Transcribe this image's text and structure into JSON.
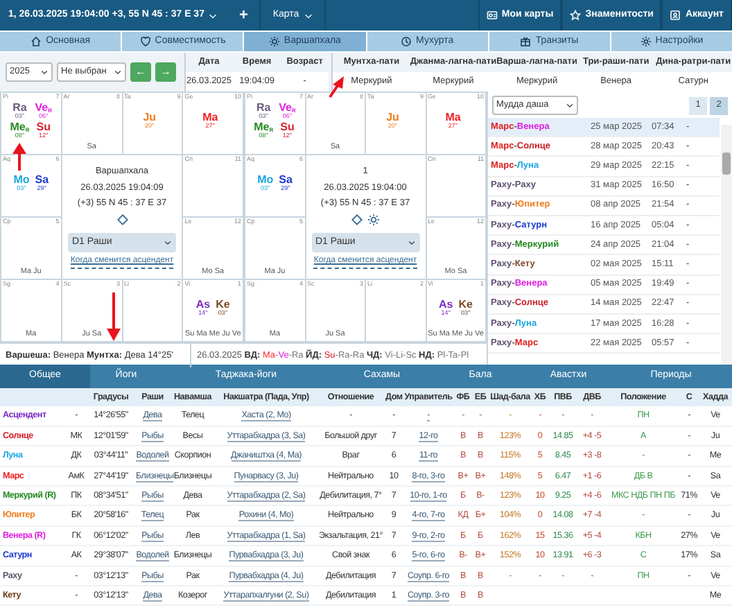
{
  "topbar": {
    "chart_label": "1, 26.03.2025 19:04:00 +3, 55 N 45 : 37 E 37",
    "add": "+",
    "menu": "Карта",
    "links": [
      {
        "kind": "charts",
        "label": "Мои карты"
      },
      {
        "kind": "celebs",
        "label": "Знаменитости"
      },
      {
        "kind": "account",
        "label": "Аккаунт"
      }
    ]
  },
  "tabs": [
    {
      "kind": "home",
      "label": "Основная",
      "selected": false
    },
    {
      "kind": "heart",
      "label": "Совместимость",
      "selected": false
    },
    {
      "kind": "sun",
      "label": "Варшапхала",
      "selected": true
    },
    {
      "kind": "clock",
      "label": "Мухурта",
      "selected": false
    },
    {
      "kind": "gift",
      "label": "Транзиты",
      "selected": false
    },
    {
      "kind": "gear",
      "label": "Настройки",
      "selected": false
    }
  ],
  "controls": {
    "year": "2025",
    "person": "Не выбран",
    "prev": "←",
    "next": "→"
  },
  "info": {
    "columns": [
      "Дата",
      "Время",
      "Возраст"
    ],
    "values": [
      "26.03.2025",
      "19:04:09",
      "-"
    ]
  },
  "lords": {
    "columns": [
      "Мунтха-пати",
      "Джанма-лагна-пати",
      "Варша-лагна-пати",
      "Три-раши-пати",
      "Дина-ратри-пати"
    ],
    "values": [
      "Меркурий",
      "Меркурий",
      "Меркурий",
      "Венера",
      "Сатурн"
    ]
  },
  "charts": [
    {
      "lines": [
        "Варшапхала",
        "26.03.2025 19:04:09",
        "(+3) 55 N 45 : 37 E 37"
      ],
      "sun_icon": false,
      "division": "D1 Раши",
      "link": "Когда сменится асцендент",
      "houses": [
        {
          "sign": "Pi",
          "num": "7",
          "planets": [
            {
              "abbr": "Ra",
              "deg": "03°",
              "color": "#6b5a80"
            },
            {
              "abbr": "Ve",
              "sub": "R",
              "deg": "06°",
              "color": "#e020e0"
            },
            {
              "abbr": "Me",
              "sub": "R",
              "deg": "08°",
              "color": "#238a23"
            },
            {
              "abbr": "Su",
              "deg": "12°",
              "color": "#d8202a"
            }
          ]
        },
        {
          "sign": "Ar",
          "num": "8",
          "bottom": "Sa"
        },
        {
          "sign": "Ta",
          "num": "9",
          "planets": [
            {
              "abbr": "Ju",
              "deg": "20°",
              "color": "#f07d1a"
            }
          ]
        },
        {
          "sign": "Ge",
          "num": "10",
          "planets": [
            {
              "abbr": "Ma",
              "deg": "27°",
              "color": "#f02020"
            }
          ]
        },
        {
          "sign": "Aq",
          "num": "6",
          "planets": [
            {
              "abbr": "Mo",
              "deg": "03°",
              "color": "#19a6e0"
            },
            {
              "abbr": "Sa",
              "deg": "29°",
              "color": "#1a3ad0"
            }
          ]
        },
        {
          "sign": "Cn",
          "num": "11"
        },
        {
          "sign": "Cp",
          "num": "5",
          "bottom": "Ma Ju"
        },
        {
          "sign": "Le",
          "num": "12",
          "bottom": "Mo Sa"
        },
        {
          "sign": "Sg",
          "num": "4",
          "bottom": "Ma"
        },
        {
          "sign": "Sc",
          "num": "3",
          "bottom": "Ju Sa"
        },
        {
          "sign": "Li",
          "num": "2"
        },
        {
          "sign": "Vi",
          "num": "1",
          "planets": [
            {
              "abbr": "As",
              "deg": "14°",
              "color": "#7a2ac0"
            },
            {
              "abbr": "Ke",
              "deg": "03°",
              "color": "#7a4a2a"
            }
          ],
          "bottom": "Su Ma Me Ju Ve"
        }
      ]
    },
    {
      "lines": [
        "1",
        "26.03.2025 19:04:00",
        "(+3) 55 N 45 : 37 E 37"
      ],
      "sun_icon": true,
      "division": "D1 Раши",
      "link": "Когда сменится асцендент",
      "houses": [
        {
          "sign": "Pi",
          "num": "7",
          "planets": [
            {
              "abbr": "Ra",
              "deg": "03°",
              "color": "#6b5a80"
            },
            {
              "abbr": "Ve",
              "sub": "R",
              "deg": "06°",
              "color": "#e020e0"
            },
            {
              "abbr": "Me",
              "sub": "R",
              "deg": "08°",
              "color": "#238a23"
            },
            {
              "abbr": "Su",
              "deg": "12°",
              "color": "#d8202a"
            }
          ]
        },
        {
          "sign": "Ar",
          "num": "8",
          "bottom": "Sa"
        },
        {
          "sign": "Ta",
          "num": "9",
          "planets": [
            {
              "abbr": "Ju",
              "deg": "20°",
              "color": "#f07d1a"
            }
          ]
        },
        {
          "sign": "Ge",
          "num": "10",
          "planets": [
            {
              "abbr": "Ma",
              "deg": "27°",
              "color": "#f02020"
            }
          ]
        },
        {
          "sign": "Aq",
          "num": "6",
          "planets": [
            {
              "abbr": "Mo",
              "deg": "03°",
              "color": "#19a6e0"
            },
            {
              "abbr": "Sa",
              "deg": "29°",
              "color": "#1a3ad0"
            }
          ]
        },
        {
          "sign": "Cn",
          "num": "11"
        },
        {
          "sign": "Cp",
          "num": "5",
          "bottom": "Ma Ju"
        },
        {
          "sign": "Le",
          "num": "12",
          "bottom": "Mo Sa"
        },
        {
          "sign": "Sg",
          "num": "4",
          "bottom": "Ma"
        },
        {
          "sign": "Sc",
          "num": "3",
          "bottom": "Ju Sa"
        },
        {
          "sign": "Li",
          "num": "2"
        },
        {
          "sign": "Vi",
          "num": "1",
          "planets": [
            {
              "abbr": "As",
              "deg": "14°",
              "color": "#7a2ac0"
            },
            {
              "abbr": "Ke",
              "deg": "03°",
              "color": "#7a4a2a"
            }
          ],
          "bottom": "Su Ma Me Ju Ve"
        }
      ]
    }
  ],
  "summary": {
    "text": "**Варшеша:** Венера **Мунтха:** Дева 14°25'",
    "date": "26.03.2025",
    "groups": [
      {
        "label": "ВД:",
        "parts": [
          {
            "text": "Ma",
            "color": "#ff3030"
          },
          {
            "text": "-"
          },
          {
            "text": "Ve",
            "color": "#e020e0"
          },
          {
            "text": "-Ra",
            "color": "#777777"
          }
        ]
      },
      {
        "label": "ЙД:",
        "parts": [
          {
            "text": "Su",
            "color": "#d8202a"
          },
          {
            "text": "-Ra-Ra",
            "color": "#777777"
          }
        ]
      },
      {
        "label": "ЧД:",
        "parts": [
          {
            "text": "Vi-Li-Sc",
            "color": "#777777"
          }
        ]
      },
      {
        "label": "НД:",
        "parts": [
          {
            "text": "Pl-Ta-Pl",
            "color": "#777777"
          }
        ]
      }
    ]
  },
  "dasha": {
    "select": "Мудда даша",
    "pages": [
      {
        "label": "1",
        "selected": false
      },
      {
        "label": "2",
        "selected": true
      }
    ],
    "rows": [
      {
        "selected": true,
        "parts": [
          {
            "text": "Марс",
            "color": "#e02020"
          },
          {
            "text": "-",
            "color": "#555555"
          },
          {
            "text": "Венера",
            "color": "#e020e0"
          }
        ],
        "date": "25 мар 2025",
        "time": "07:34",
        "end": "-"
      },
      {
        "selected": false,
        "parts": [
          {
            "text": "Марс",
            "color": "#e02020"
          },
          {
            "text": "-",
            "color": "#555555"
          },
          {
            "text": "Солнце",
            "color": "#c8202a"
          }
        ],
        "date": "28 мар 2025",
        "time": "20:43",
        "end": "-"
      },
      {
        "selected": false,
        "parts": [
          {
            "text": "Марс",
            "color": "#e02020"
          },
          {
            "text": "-",
            "color": "#555555"
          },
          {
            "text": "Луна",
            "color": "#19a6e0"
          }
        ],
        "date": "29 мар 2025",
        "time": "22:15",
        "end": "-"
      },
      {
        "selected": false,
        "parts": [
          {
            "text": "Раху",
            "color": "#5e5070"
          },
          {
            "text": "-",
            "color": "#555555"
          },
          {
            "text": "Раху",
            "color": "#5e5070"
          }
        ],
        "date": "31 мар 2025",
        "time": "16:50",
        "end": "-"
      },
      {
        "selected": false,
        "parts": [
          {
            "text": "Раху",
            "color": "#5e5070"
          },
          {
            "text": "-",
            "color": "#555555"
          },
          {
            "text": "Юпитер",
            "color": "#f07d1a"
          }
        ],
        "date": "08 апр 2025",
        "time": "21:54",
        "end": "-"
      },
      {
        "selected": false,
        "parts": [
          {
            "text": "Раху",
            "color": "#5e5070"
          },
          {
            "text": "-",
            "color": "#555555"
          },
          {
            "text": "Сатурн",
            "color": "#1a3ad0"
          }
        ],
        "date": "16 апр 2025",
        "time": "05:04",
        "end": "-"
      },
      {
        "selected": false,
        "parts": [
          {
            "text": "Раху",
            "color": "#5e5070"
          },
          {
            "text": "-",
            "color": "#555555"
          },
          {
            "text": "Меркурий",
            "color": "#238a23"
          }
        ],
        "date": "24 апр 2025",
        "time": "21:04",
        "end": "-"
      },
      {
        "selected": false,
        "parts": [
          {
            "text": "Раху",
            "color": "#5e5070"
          },
          {
            "text": "-",
            "color": "#555555"
          },
          {
            "text": "Кету",
            "color": "#7a4a2a"
          }
        ],
        "date": "02 мая 2025",
        "time": "15:11",
        "end": "-"
      },
      {
        "selected": false,
        "parts": [
          {
            "text": "Раху",
            "color": "#5e5070"
          },
          {
            "text": "-",
            "color": "#555555"
          },
          {
            "text": "Венера",
            "color": "#e020e0"
          }
        ],
        "date": "05 мая 2025",
        "time": "19:49",
        "end": "-"
      },
      {
        "selected": false,
        "parts": [
          {
            "text": "Раху",
            "color": "#5e5070"
          },
          {
            "text": "-",
            "color": "#555555"
          },
          {
            "text": "Солнце",
            "color": "#c8202a"
          }
        ],
        "date": "14 мая 2025",
        "time": "22:47",
        "end": "-"
      },
      {
        "selected": false,
        "parts": [
          {
            "text": "Раху",
            "color": "#5e5070"
          },
          {
            "text": "-",
            "color": "#555555"
          },
          {
            "text": "Луна",
            "color": "#19a6e0"
          }
        ],
        "date": "17 мая 2025",
        "time": "16:28",
        "end": "-"
      },
      {
        "selected": false,
        "parts": [
          {
            "text": "Раху",
            "color": "#5e5070"
          },
          {
            "text": "-",
            "color": "#555555"
          },
          {
            "text": "Марс",
            "color": "#e02020"
          }
        ],
        "date": "22 мая 2025",
        "time": "05:57",
        "end": "-"
      }
    ]
  },
  "table_tabs": [
    {
      "label": "Общее",
      "selected": true
    },
    {
      "label": "Йоги",
      "selected": false
    },
    {
      "label": "Таджака-йоги",
      "selected": false
    },
    {
      "label": "Сахамы",
      "selected": false
    },
    {
      "label": "Бала",
      "selected": false
    },
    {
      "label": "Авастхи",
      "selected": false
    },
    {
      "label": "Периоды",
      "selected": false
    }
  ],
  "table": {
    "columns": [
      "",
      "Градусы",
      "Раши",
      "Навамша",
      "Накшатра (Пада, Упр)",
      "Отношение",
      "Дом",
      "Управитель",
      "ФБ",
      "ЕБ",
      "Шад-бала",
      "ХБ",
      "ПВБ",
      "ДВБ",
      "Положение",
      "С",
      "Хадда"
    ],
    "rows": [
      {
        "name": "Асцендент",
        "color": "#7a2ac0",
        "cells": [
          "-",
          "14°26'55\"",
          "Дева",
          "Телец",
          "Хаста (2, Mo)",
          "-",
          "-",
          "-",
          "-",
          "-",
          "-",
          "-",
          "-",
          "-",
          "ПН",
          "-",
          "Ve"
        ]
      },
      {
        "name": "Солнце",
        "color": "#d8202a",
        "cells": [
          "МК",
          "12°01'59\"",
          "Рыбы",
          "Весы",
          "Уттарабхадра (3, Sa)",
          "Большой друг",
          "7",
          "12-го",
          "В",
          "В",
          "123%",
          "0",
          "14.85",
          "+4 -5",
          "А",
          "-",
          "Ju"
        ]
      },
      {
        "name": "Луна",
        "color": "#19a6e0",
        "cells": [
          "ДК",
          "03°44'11\"",
          "Водолей",
          "Скорпион",
          "Джаништха (4, Ma)",
          "Враг",
          "6",
          "11-го",
          "В",
          "В",
          "115%",
          "5",
          "8.45",
          "+3 -8",
          "-",
          "-",
          "Me"
        ]
      },
      {
        "name": "Марс",
        "color": "#f02020",
        "cells": [
          "АмК",
          "27°44'19\"",
          "Близнецы",
          "Близнецы",
          "Пунарвасу (3, Ju)",
          "Нейтрально",
          "10",
          "8-го, 3-го",
          "В+",
          "В+",
          "148%",
          "5",
          "6.47",
          "+1 -6",
          "ДБ В",
          "-",
          "Sa"
        ]
      },
      {
        "name": "Меркурий (R)",
        "color": "#238a23",
        "cells": [
          "ПК",
          "08°34'51\"",
          "Рыбы",
          "Дева",
          "Уттарабхадра (2, Sa)",
          "Дебилитация, 7°",
          "7",
          "10-го, 1-го",
          "Б",
          "В-",
          "123%",
          "10",
          "9.25",
          "+4 -6",
          "МКС НДБ ПН ПБ",
          "71%",
          "Ve"
        ]
      },
      {
        "name": "Юпитер",
        "color": "#f07d1a",
        "cells": [
          "БК",
          "20°58'16\"",
          "Телец",
          "Рак",
          "Рохини (4, Mo)",
          "Нейтрально",
          "9",
          "4-го, 7-го",
          "КД",
          "Б+",
          "104%",
          "0",
          "14.08",
          "+7 -4",
          "-",
          "-",
          "Ju"
        ]
      },
      {
        "name": "Венера (R)",
        "color": "#e020e0",
        "cells": [
          "ГК",
          "06°12'02\"",
          "Рыбы",
          "Лев",
          "Уттарабхадра (1, Sa)",
          "Экзальтация, 21°",
          "7",
          "9-го, 2-го",
          "Б",
          "Б",
          "162%",
          "15",
          "15.36",
          "+5 -4",
          "КБН",
          "27%",
          "Ve"
        ]
      },
      {
        "name": "Сатурн",
        "color": "#1a3ad0",
        "cells": [
          "АК",
          "29°38'07\"",
          "Водолей",
          "Близнецы",
          "Пурвабхадра (3, Ju)",
          "Свой знак",
          "6",
          "5-го, 6-го",
          "В-",
          "В+",
          "152%",
          "10",
          "13.91",
          "+6 -3",
          "С",
          "17%",
          "Sa"
        ]
      },
      {
        "name": "Раху",
        "color": "#5e5070",
        "cells": [
          "-",
          "03°12'13\"",
          "Рыбы",
          "Рак",
          "Пурвабхадра (4, Ju)",
          "Дебилитация",
          "7",
          "Соупр. 6-го",
          "В",
          "В",
          "-",
          "-",
          "-",
          "-",
          "ПН",
          "-",
          "Ve"
        ]
      },
      {
        "name": "Кету",
        "color": "#6a3a1a",
        "cells": [
          "-",
          "03°12'13\"",
          "Дева",
          "Козерог",
          "Уттарапхалгуни (2, Su)",
          "Дебилитация",
          "1",
          "Соупр. 3-го",
          "В",
          "В",
          null,
          null,
          null,
          null,
          null,
          null,
          "Me"
        ]
      }
    ]
  }
}
